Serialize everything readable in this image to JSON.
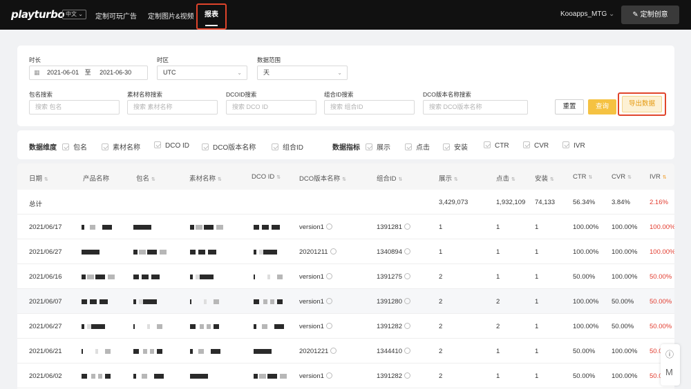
{
  "header": {
    "logo": "playturbo",
    "lang": "中文",
    "nav": [
      "定制可玩广告",
      "定制图片&视频",
      "报表"
    ],
    "account": "Kooapps_MTG",
    "create": "定制创意"
  },
  "filters": {
    "duration_label": "时长",
    "date_start": "2021-06-01",
    "date_sep": "至",
    "date_end": "2021-06-30",
    "tz_label": "时区",
    "tz_value": "UTC",
    "range_label": "数据范围",
    "range_value": "天",
    "pkg_label": "包名搜索",
    "pkg_ph": "搜索 包名",
    "mat_label": "素材名称搜索",
    "mat_ph": "搜索 素材名称",
    "dco_label": "DCOID搜索",
    "dco_ph": "搜索 DCO ID",
    "grp_label": "组合ID搜索",
    "grp_ph": "搜索 组合ID",
    "dcov_label": "DCO版本名称搜索",
    "dcov_ph": "搜索 DCO版本名称",
    "reset": "重置",
    "query": "查询",
    "export": "导出数据"
  },
  "dims": {
    "label": "数据维度",
    "items": [
      "包名",
      "素材名称",
      "DCO ID",
      "DCO版本名称",
      "组合ID"
    ]
  },
  "metrics": {
    "label": "数据指标",
    "items": [
      "展示",
      "点击",
      "安装",
      "CTR",
      "CVR",
      "IVR"
    ]
  },
  "table": {
    "headers": [
      "日期",
      "产品名称",
      "包名",
      "素材名称",
      "DCO ID",
      "DCO版本名称",
      "组合ID",
      "展示",
      "点击",
      "安装",
      "CTR",
      "CVR",
      "IVR"
    ],
    "total": {
      "label": "总计",
      "impr": "3,429,073",
      "clicks": "1,932,109",
      "installs": "74,133",
      "ctr": "56.34%",
      "cvr": "3.84%",
      "ivr": "2.16%"
    },
    "rows": [
      {
        "date": "2021/06/17",
        "version": "version1",
        "group": "1391281",
        "impr": "1",
        "clicks": "1",
        "installs": "1",
        "ctr": "100.00%",
        "cvr": "100.00%",
        "ivr": "100.00%"
      },
      {
        "date": "2021/06/27",
        "version": "20201211",
        "group": "1340894",
        "impr": "1",
        "clicks": "1",
        "installs": "1",
        "ctr": "100.00%",
        "cvr": "100.00%",
        "ivr": "100.00%"
      },
      {
        "date": "2021/06/16",
        "version": "version1",
        "group": "1391275",
        "impr": "2",
        "clicks": "1",
        "installs": "1",
        "ctr": "50.00%",
        "cvr": "100.00%",
        "ivr": "50.00%"
      },
      {
        "date": "2021/06/07",
        "version": "version1",
        "group": "1391280",
        "impr": "2",
        "clicks": "2",
        "installs": "1",
        "ctr": "100.00%",
        "cvr": "50.00%",
        "ivr": "50.00%"
      },
      {
        "date": "2021/06/27",
        "version": "version1",
        "group": "1391282",
        "impr": "2",
        "clicks": "2",
        "installs": "1",
        "ctr": "100.00%",
        "cvr": "50.00%",
        "ivr": "50.00%"
      },
      {
        "date": "2021/06/21",
        "version": "20201221",
        "group": "1344410",
        "impr": "2",
        "clicks": "1",
        "installs": "1",
        "ctr": "50.00%",
        "cvr": "100.00%",
        "ivr": "50.0"
      },
      {
        "date": "2021/06/02",
        "version": "version1",
        "group": "1391282",
        "impr": "2",
        "clicks": "1",
        "installs": "1",
        "ctr": "50.00%",
        "cvr": "100.00%",
        "ivr": "50.0"
      }
    ]
  }
}
